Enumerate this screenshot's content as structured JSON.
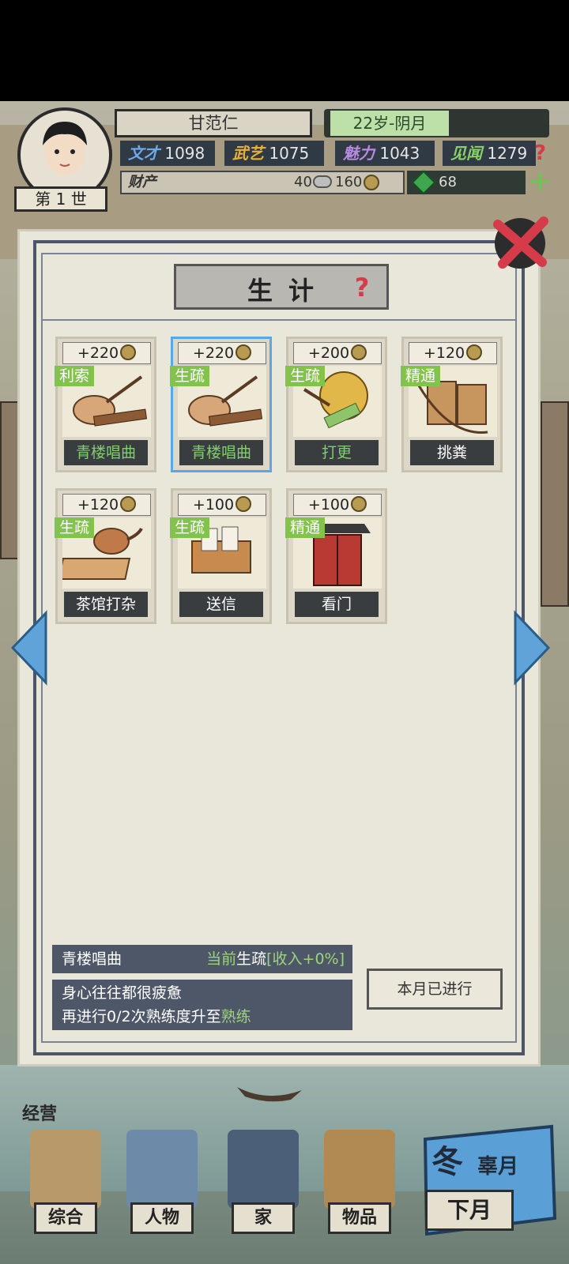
{
  "header": {
    "name": "甘范仁",
    "age_month": "22岁-阴月",
    "generation": "第 1 世",
    "stats": [
      {
        "label": "文才",
        "value": "1098",
        "color": "#6ea8e8"
      },
      {
        "label": "武艺",
        "value": "1075",
        "color": "#e6b13a"
      },
      {
        "label": "魅力",
        "value": "1043",
        "color": "#b78be0"
      },
      {
        "label": "见闻",
        "value": "1279",
        "color": "#8bd06a"
      }
    ],
    "wealth_label": "财产",
    "silver": "40",
    "copper": "160",
    "gems": "68"
  },
  "dialog": {
    "title": "生计",
    "jobs": [
      {
        "income": "+220",
        "tag": "利索",
        "label": "青楼唱曲",
        "label_color": "green",
        "selected": false
      },
      {
        "income": "+220",
        "tag": "生疏",
        "label": "青楼唱曲",
        "label_color": "green",
        "selected": true
      },
      {
        "income": "+200",
        "tag": "生疏",
        "label": "打更",
        "label_color": "green",
        "selected": false
      },
      {
        "income": "+120",
        "tag": "精通",
        "label": "挑粪",
        "label_color": "white",
        "selected": false
      },
      {
        "income": "+120",
        "tag": "生疏",
        "label": "茶馆打杂",
        "label_color": "white",
        "selected": false
      },
      {
        "income": "+100",
        "tag": "生疏",
        "label": "送信",
        "label_color": "white",
        "selected": false
      },
      {
        "income": "+100",
        "tag": "精通",
        "label": "看门",
        "label_color": "white",
        "selected": false
      }
    ],
    "info": {
      "job_name": "青楼唱曲",
      "status_prefix": "当前",
      "status_level": "生疏",
      "status_bonus": "[收入+0%]",
      "desc_line1": "身心往往都很疲惫",
      "desc_line2_prefix": "再进行0/2次熟练度升至",
      "desc_line2_level": "熟练"
    },
    "action_button": "本月已进行"
  },
  "nav": {
    "section_title": "经营",
    "items": [
      {
        "label": "综合"
      },
      {
        "label": "人物"
      },
      {
        "label": "家"
      },
      {
        "label": "物品"
      }
    ],
    "season": "冬",
    "month": "辜月",
    "next_month": "下月"
  },
  "colors": {
    "accent_green": "#84c24e",
    "selected_border": "#5aa6e6",
    "panel": "#4e5768",
    "help_red": "#d63b4a"
  }
}
